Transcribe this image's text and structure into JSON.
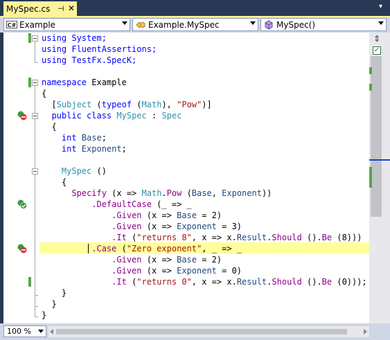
{
  "tab": {
    "title": "MySpec.cs"
  },
  "navbar": {
    "project": {
      "icon": "C#",
      "label": "Example"
    },
    "type": {
      "label": "Example.MySpec"
    },
    "member": {
      "label": "MySpec()"
    }
  },
  "code": {
    "using1": "using System;",
    "using2": "using FluentAssertions;",
    "using3": "using TestFx.SpecK;",
    "ns_kw": "namespace",
    "ns_name": " Example",
    "brace_open_1": "{",
    "attr_open": "  [",
    "attr_name": "Subject",
    "attr_mid1": " (",
    "attr_typeof": "typeof",
    "attr_mid2": " (",
    "attr_math": "Math",
    "attr_mid3": "), ",
    "attr_pow": "\"Pow\"",
    "attr_close": ")]",
    "class_kw": "  public class",
    "class_sp": " ",
    "class_name": "MySpec",
    "class_colon": " : ",
    "class_base": "Spec",
    "brace_open_2": "  {",
    "prop1_kw": "    int",
    "prop1_name": " Base",
    "prop1_end": ";",
    "prop2_kw": "    int",
    "prop2_name": " Exponent",
    "prop2_end": ";",
    "ctor_indent": "    ",
    "ctor_name": "MySpec",
    "ctor_params": " ()",
    "brace_open_3": "    {",
    "spec_indent": "      ",
    "spec_call": "Specify",
    "spec_a": " (x => ",
    "spec_math": "Math",
    "spec_dot": ".",
    "spec_pow": "Pow",
    "spec_b": " (",
    "spec_base": "Base",
    "spec_c": ", ",
    "spec_exp": "Exponent",
    "spec_d": "))",
    "dc_indent": "          ",
    "dc_name": ".DefaultCase",
    "dc_rest": " (_ => _",
    "g1_indent": "              ",
    "g1_name": ".Given",
    "g1_a": " (x => ",
    "g1_prop": "Base",
    "g1_b": " = 2)",
    "g2_indent": "              ",
    "g2_name": ".Given",
    "g2_a": " (x => ",
    "g2_prop": "Exponent",
    "g2_b": " = 3)",
    "it1_indent": "              ",
    "it1_name": ".It",
    "it1_a": " (",
    "it1_str": "\"returns 8\"",
    "it1_b": ", x => x.",
    "it1_result": "Result",
    "it1_c": ".",
    "it1_should": "Should",
    "it1_d": " ().",
    "it1_be": "Be",
    "it1_e": " (8)))",
    "case_indent": "          ",
    "case_name": ".Case",
    "case_a": " (",
    "case_str": "\"Zero exponent\"",
    "case_b": ", _ => _",
    "g3_indent": "              ",
    "g3_name": ".Given",
    "g3_a": " (x => ",
    "g3_prop": "Base",
    "g3_b": " = 2)",
    "g4_indent": "              ",
    "g4_name": ".Given",
    "g4_a": " (x => ",
    "g4_prop": "Exponent",
    "g4_b": " = 0)",
    "it2_indent": "              ",
    "it2_name": ".It",
    "it2_a": " (",
    "it2_str": "\"returns 0\"",
    "it2_b": ", x => x.",
    "it2_result": "Result",
    "it2_c": ".",
    "it2_should": "Should",
    "it2_d": " ().",
    "it2_be": "Be",
    "it2_e": " (0)));",
    "brace_close_3": "    }",
    "brace_close_2": "  }",
    "brace_close_1": "}"
  },
  "status": {
    "zoom": "100 %"
  },
  "colors": {
    "keyword": "#0000FF",
    "type": "#2B91AF",
    "string": "#A31515",
    "member": "#8B008B",
    "property": "#1F497D",
    "tab_active": "#FFF29D",
    "highlight_line": "#FFFF99",
    "change_marker": "#57A64A"
  },
  "gutter_icons": [
    "passed-failed-icon",
    "passed-icon",
    "failed-icon"
  ]
}
